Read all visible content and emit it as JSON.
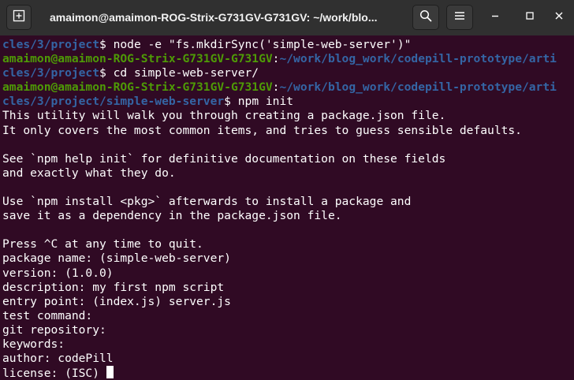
{
  "window": {
    "title": "amaimon@amaimon-ROG-Strix-G731GV-G731GV: ~/work/blo..."
  },
  "icons": {
    "new_tab": "new-tab-icon",
    "search": "search-icon",
    "menu": "hamburger-menu-icon",
    "minimize": "minimize-icon",
    "maximize": "maximize-icon",
    "close": "close-icon"
  },
  "colors": {
    "terminal_bg": "#300a24",
    "prompt_user": "#4e9a06",
    "prompt_path": "#3465a4",
    "text": "#ffffff",
    "titlebar_bg": "#303030"
  },
  "terminal": {
    "lines": [
      [
        {
          "t": "path",
          "s": "cles/3/project"
        },
        {
          "t": "plain",
          "s": "$ node -e \"fs.mkdirSync('simple-web-server')\""
        }
      ],
      [
        {
          "t": "user",
          "s": "amaimon@amaimon-ROG-Strix-G731GV-G731GV"
        },
        {
          "t": "plain",
          "s": ":"
        },
        {
          "t": "path",
          "s": "~/work/blog_work/codepill-prototype/arti"
        }
      ],
      [
        {
          "t": "path",
          "s": "cles/3/project"
        },
        {
          "t": "plain",
          "s": "$ cd simple-web-server/"
        }
      ],
      [
        {
          "t": "user",
          "s": "amaimon@amaimon-ROG-Strix-G731GV-G731GV"
        },
        {
          "t": "plain",
          "s": ":"
        },
        {
          "t": "path",
          "s": "~/work/blog_work/codepill-prototype/arti"
        }
      ],
      [
        {
          "t": "path",
          "s": "cles/3/project/simple-web-server"
        },
        {
          "t": "plain",
          "s": "$ npm init"
        }
      ],
      [
        {
          "t": "plain",
          "s": "This utility will walk you through creating a package.json file."
        }
      ],
      [
        {
          "t": "plain",
          "s": "It only covers the most common items, and tries to guess sensible defaults."
        }
      ],
      [
        {
          "t": "plain",
          "s": ""
        }
      ],
      [
        {
          "t": "plain",
          "s": "See `npm help init` for definitive documentation on these fields"
        }
      ],
      [
        {
          "t": "plain",
          "s": "and exactly what they do."
        }
      ],
      [
        {
          "t": "plain",
          "s": ""
        }
      ],
      [
        {
          "t": "plain",
          "s": "Use `npm install <pkg>` afterwards to install a package and"
        }
      ],
      [
        {
          "t": "plain",
          "s": "save it as a dependency in the package.json file."
        }
      ],
      [
        {
          "t": "plain",
          "s": ""
        }
      ],
      [
        {
          "t": "plain",
          "s": "Press ^C at any time to quit."
        }
      ],
      [
        {
          "t": "plain",
          "s": "package name: (simple-web-server)"
        }
      ],
      [
        {
          "t": "plain",
          "s": "version: (1.0.0)"
        }
      ],
      [
        {
          "t": "plain",
          "s": "description: my first npm script"
        }
      ],
      [
        {
          "t": "plain",
          "s": "entry point: (index.js) server.js"
        }
      ],
      [
        {
          "t": "plain",
          "s": "test command:"
        }
      ],
      [
        {
          "t": "plain",
          "s": "git repository:"
        }
      ],
      [
        {
          "t": "plain",
          "s": "keywords:"
        }
      ],
      [
        {
          "t": "plain",
          "s": "author: codePill"
        }
      ],
      [
        {
          "t": "plain",
          "s": "license: (ISC) "
        }
      ]
    ]
  }
}
